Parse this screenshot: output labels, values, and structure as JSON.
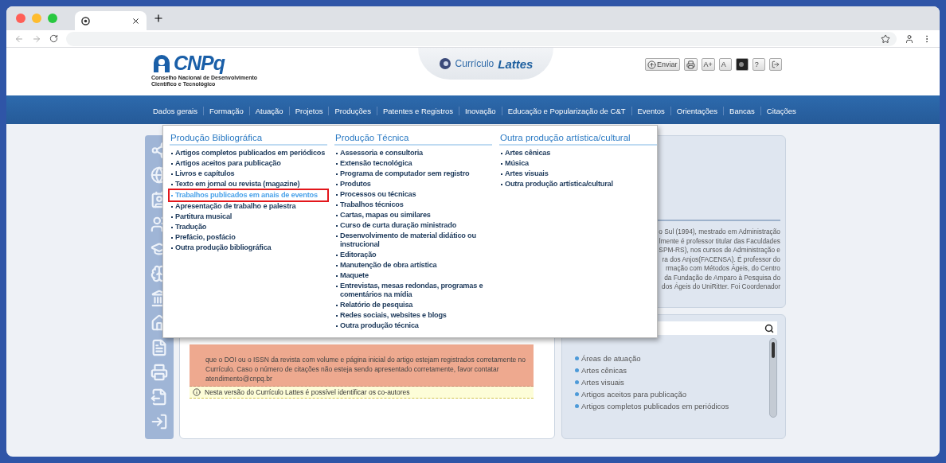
{
  "header": {
    "logo": {
      "name": "CNPq",
      "subtitle": [
        "Conselho Nacional de Desenvolvimento",
        "Científico e Tecnológico"
      ]
    },
    "product": {
      "prefix": "Currículo",
      "name": "Lattes"
    },
    "tools": [
      {
        "kind": "send",
        "label": "Enviar"
      },
      {
        "kind": "print"
      },
      {
        "kind": "text",
        "label": "A+"
      },
      {
        "kind": "text",
        "label": "A"
      },
      {
        "kind": "contrast"
      },
      {
        "kind": "text",
        "label": "?"
      },
      {
        "kind": "exit"
      }
    ]
  },
  "nav": [
    "Dados gerais",
    "Formação",
    "Atuação",
    "Projetos",
    "Produções",
    "Patentes e Registros",
    "Inovação",
    "Educação e Popularização de C&T",
    "Eventos",
    "Orientações",
    "Bancas",
    "Citações"
  ],
  "menu": {
    "columns": [
      {
        "title": "Produção Bibliográfica",
        "items": [
          {
            "label": "Artigos completos publicados em periódicos",
            "selected": false
          },
          {
            "label": "Artigos aceitos para publicação",
            "selected": false
          },
          {
            "label": "Livros e capítulos",
            "selected": false
          },
          {
            "label": "Texto em jornal ou revista (magazine)",
            "selected": false
          },
          {
            "label": "Trabalhos publicados em anais de eventos",
            "selected": true
          },
          {
            "label": "Apresentação de trabalho e palestra",
            "selected": false
          },
          {
            "label": "Partitura musical",
            "selected": false
          },
          {
            "label": "Tradução",
            "selected": false
          },
          {
            "label": "Prefácio, posfácio",
            "selected": false
          },
          {
            "label": "Outra produção bibliográfica",
            "selected": false
          }
        ]
      },
      {
        "title": "Produção Técnica",
        "items": [
          {
            "label": "Assessoria e consultoria",
            "selected": false
          },
          {
            "label": "Extensão tecnológica",
            "selected": false
          },
          {
            "label": "Programa de computador sem registro",
            "selected": false
          },
          {
            "label": "Produtos",
            "selected": false
          },
          {
            "label": "Processos ou técnicas",
            "selected": false
          },
          {
            "label": "Trabalhos técnicos",
            "selected": false
          },
          {
            "label": "Cartas, mapas ou similares",
            "selected": false
          },
          {
            "label": "Curso de curta duração ministrado",
            "selected": false
          },
          {
            "label": "Desenvolvimento de material didático ou instrucional",
            "selected": false
          },
          {
            "label": "Editoração",
            "selected": false
          },
          {
            "label": "Manutenção de obra artística",
            "selected": false
          },
          {
            "label": "Maquete",
            "selected": false
          },
          {
            "label": "Entrevistas, mesas redondas, programas e comentários na mídia",
            "selected": false
          },
          {
            "label": "Relatório de pesquisa",
            "selected": false
          },
          {
            "label": "Redes sociais, websites e blogs",
            "selected": false
          },
          {
            "label": "Outra produção técnica",
            "selected": false
          }
        ]
      },
      {
        "title": "Outra produção artística/cultural",
        "items": [
          {
            "label": "Artes cênicas",
            "selected": false
          },
          {
            "label": "Música",
            "selected": false
          },
          {
            "label": "Artes visuais",
            "selected": false
          },
          {
            "label": "Outra produção artística/cultural",
            "selected": false
          }
        ]
      }
    ]
  },
  "alert": {
    "lines": [
      "que o DOI ou o ISSN da revista com volume e página inicial do artigo estejam registrados corretamente no",
      "Currículo. Caso o número de citações não esteja sendo apresentado corretamente, favor contatar",
      "atendimento@cnpq.br"
    ]
  },
  "notice": "Nesta versão do Currículo Lattes é possível identificar os co-autores",
  "bio": {
    "lines": [
      "o Sul (1994), mestrado em Administração",
      "lmente é professor titular das Faculdades",
      "SPM-RS), nos cursos de Administração e",
      "ra dos Anjos(FACENSA). É professor do",
      "rmação com Métodos Ágeis, do Centro",
      "da Fundação de Amparo à Pesquisa do",
      "dos Ágeis do UniRitter. Foi Coordenador"
    ]
  },
  "index": {
    "items": [
      "Áreas de atuação",
      "Artes cênicas",
      "Artes visuais",
      "Artigos aceitos para publicação",
      "Artigos completos publicados em periódicos"
    ]
  }
}
